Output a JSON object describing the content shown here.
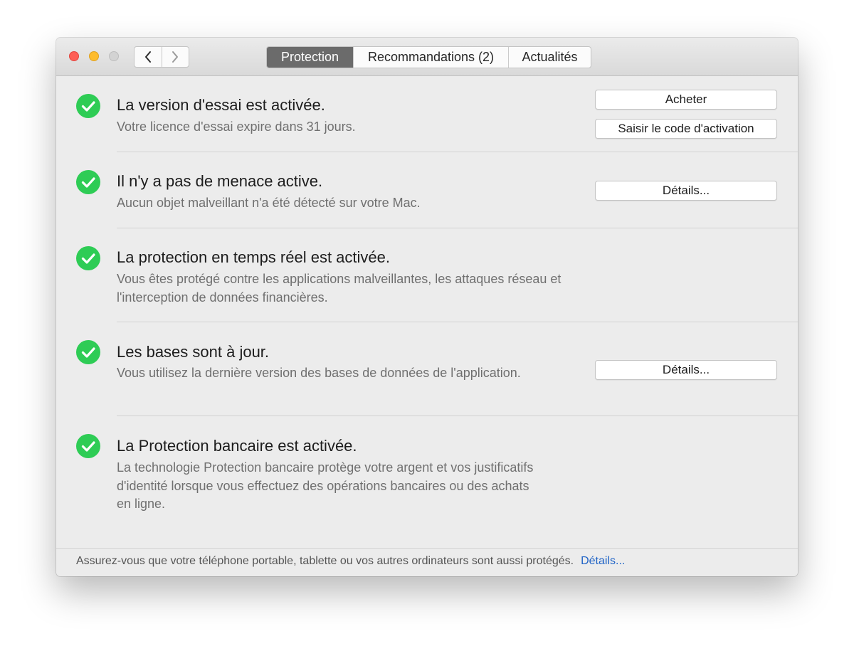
{
  "window": {
    "traffic_lights": [
      "close",
      "minimize",
      "zoom"
    ],
    "nav": {
      "back_icon": "chevron-left-icon",
      "forward_icon": "chevron-right-icon"
    },
    "tabs": [
      {
        "label": "Protection",
        "active": true
      },
      {
        "label": "Recommandations (2)",
        "active": false
      },
      {
        "label": "Actualités",
        "active": false
      }
    ]
  },
  "status_items": [
    {
      "icon": "check-circle-icon",
      "title": "La version d'essai est activée.",
      "description": "Votre licence d'essai expire dans 31 jours.",
      "buttons": [
        "Acheter",
        "Saisir le code d'activation"
      ]
    },
    {
      "icon": "check-circle-icon",
      "title": "Il n'y a pas de menace active.",
      "description": "Aucun objet malveillant n'a été détecté sur votre Mac.",
      "buttons": [
        "Détails..."
      ]
    },
    {
      "icon": "check-circle-icon",
      "title": "La protection en temps réel est activée.",
      "description": "Vous êtes protégé contre les applications malveillantes, les attaques réseau et l'interception de données financières.",
      "buttons": []
    },
    {
      "icon": "check-circle-icon",
      "title": "Les bases sont à jour.",
      "description": "Vous utilisez la dernière version des bases de données de l'application.",
      "buttons": [
        "Détails..."
      ]
    },
    {
      "icon": "check-circle-icon",
      "title": "La Protection bancaire est activée.",
      "description": "La technologie Protection bancaire protège votre argent et vos justificatifs d'identité lorsque vous effectuez des opérations bancaires ou des achats en ligne.",
      "buttons": []
    }
  ],
  "footer": {
    "text": "Assurez-vous que votre téléphone portable, tablette ou vos autres ordinateurs sont aussi protégés.",
    "link": "Détails..."
  },
  "colors": {
    "check_green": "#2ecc55",
    "link_blue": "#1f63c6",
    "active_tab": "#6b6b6b"
  }
}
